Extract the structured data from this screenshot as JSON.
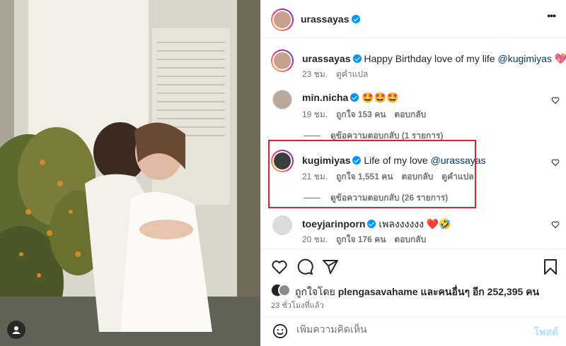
{
  "header": {
    "username": "urassayas",
    "more_label": "•••"
  },
  "caption": {
    "username": "urassayas",
    "text": "Happy Birthday love of my life",
    "mention": "@kugimiyas",
    "emoji": "💖",
    "time": "23 ชม.",
    "translate": "ดูคำแปล"
  },
  "comments": [
    {
      "username": "min.nicha",
      "text": "🤩🤩🤩",
      "mention": "",
      "time": "19 ชม.",
      "likes": "ถูกใจ 153 คน",
      "reply": "ตอบกลับ",
      "translate": "",
      "view_replies": "ดูข้อความตอบกลับ (1 รายการ)"
    },
    {
      "username": "kugimiyas",
      "text": "Life of my love",
      "mention": "@urassayas",
      "time": "21 ชม.",
      "likes": "ถูกใจ 1,551 คน",
      "reply": "ตอบกลับ",
      "translate": "ดูคำแปล",
      "view_replies": "ดูข้อความตอบกลับ (26 รายการ)"
    },
    {
      "username": "toeyjarinporn",
      "text": "เพลงงงงงง ❤️🤣",
      "mention": "",
      "time": "20 ชม.",
      "likes": "ถูกใจ 176 คน",
      "reply": "ตอบกลับ",
      "translate": "",
      "view_replies": ""
    }
  ],
  "likes": {
    "prefix": "ถูกใจโดย",
    "user": "plengasavahame",
    "suffix": "และคนอื่นๆ อีก 252,395 คน"
  },
  "timestamp": "23 ชั่วโมงที่แล้ว",
  "add_comment": {
    "placeholder": "เพิ่มความคิดเห็น",
    "post_label": "โพสต์"
  },
  "colors": {
    "verified": "#0095f6",
    "mention": "#00376b",
    "highlight_box": "#e0202a",
    "post_button": "#b2dffc"
  },
  "icons": [
    "tag-user-icon",
    "more-icon",
    "heart-icon",
    "comment-icon",
    "share-icon",
    "bookmark-icon",
    "emoji-icon",
    "verified-badge-icon"
  ]
}
